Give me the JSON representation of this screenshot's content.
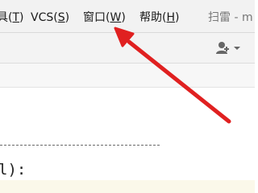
{
  "menubar": {
    "items": [
      {
        "label": "具(",
        "mnemonic": "T",
        "suffix": ")"
      },
      {
        "label": "VCS(",
        "mnemonic": "S",
        "suffix": ")"
      },
      {
        "label": "窗口(",
        "mnemonic": "W",
        "suffix": ")"
      },
      {
        "label": "帮助(",
        "mnemonic": "H",
        "suffix": ")"
      }
    ],
    "window_title": "扫雷 - m"
  },
  "toolbar": {
    "user_menu_icon": "user-dropdown-icon"
  },
  "editor": {
    "code_tail": "l):"
  },
  "annotation": {
    "arrow_color": "#e02020"
  }
}
